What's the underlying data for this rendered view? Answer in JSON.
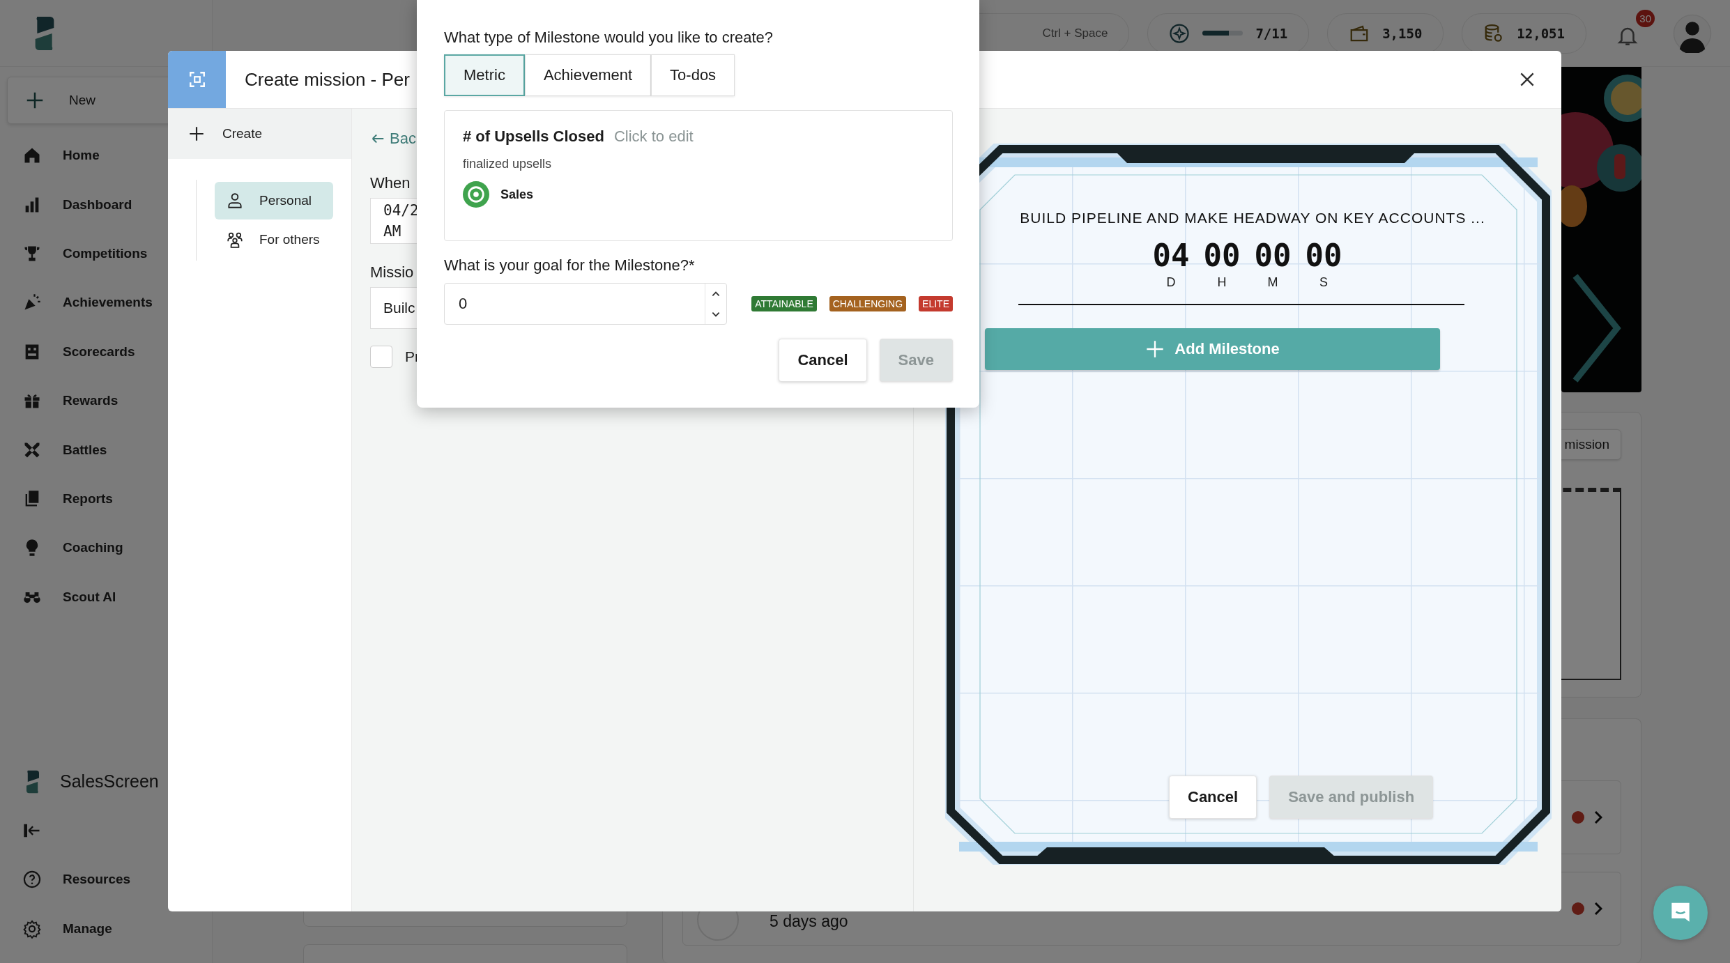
{
  "sidebar": {
    "new_label": "New",
    "nav": [
      {
        "label": "Home"
      },
      {
        "label": "Dashboard"
      },
      {
        "label": "Competitions"
      },
      {
        "label": "Achievements"
      },
      {
        "label": "Scorecards"
      },
      {
        "label": "Rewards"
      },
      {
        "label": "Battles"
      },
      {
        "label": "Reports"
      },
      {
        "label": "Coaching"
      },
      {
        "label": "Scout AI"
      }
    ],
    "brand": "SalesScreen",
    "bottom_nav": [
      {
        "label": "Resources"
      },
      {
        "label": "Manage"
      }
    ]
  },
  "topbar": {
    "search_hint": "Ctrl + Space",
    "progress": {
      "level": 0.65,
      "reading": "7/11"
    },
    "wallet": "3,150",
    "coins": "12,051",
    "notifications": "30"
  },
  "background": {
    "mission_button": "mission",
    "activity_time": "5 days ago"
  },
  "modal": {
    "title": "Create mission - Per",
    "create_label": "Create",
    "audience": [
      {
        "label": "Personal",
        "selected": true
      },
      {
        "label": "For others",
        "selected": false
      }
    ],
    "back_link": "Bac",
    "when_label": "When",
    "date_value": "04/2 AM",
    "mission_label": "Missio",
    "mission_value": "Builc",
    "private_option": {
      "label": "Pr",
      "checked": false
    }
  },
  "milestone_popup": {
    "question": "What type of Milestone would you like to create?",
    "types": [
      {
        "label": "Metric",
        "selected": true
      },
      {
        "label": "Achievement",
        "selected": false
      },
      {
        "label": "To-dos",
        "selected": false
      }
    ],
    "metric": {
      "title": "# of Upsells Closed",
      "edit_hint": "Click to edit",
      "description": "finalized upsells",
      "category": "Sales"
    },
    "goal_label": "What is your goal for the Milestone?*",
    "goal_value": "0",
    "levels": [
      {
        "label": "ATTAINABLE",
        "color": "#2f7a34"
      },
      {
        "label": "CHALLENGING",
        "color": "#a4621f"
      },
      {
        "label": "ELITE",
        "color": "#c43a2e"
      }
    ],
    "buttons": [
      {
        "label": "Cancel",
        "disabled": false
      },
      {
        "label": "Save",
        "disabled": true
      }
    ]
  },
  "mission_card": {
    "title": "BUILD PIPELINE AND MAKE HEADWAY ON KEY ACCOUNTS ...",
    "countdown": [
      {
        "value": "04",
        "unit": "D"
      },
      {
        "value": "00",
        "unit": "H"
      },
      {
        "value": "00",
        "unit": "M"
      },
      {
        "value": "00",
        "unit": "S"
      }
    ],
    "add_label": "Add Milestone",
    "buttons": [
      {
        "label": "Cancel",
        "disabled": false
      },
      {
        "label": "Save and publish",
        "disabled": true
      }
    ]
  }
}
